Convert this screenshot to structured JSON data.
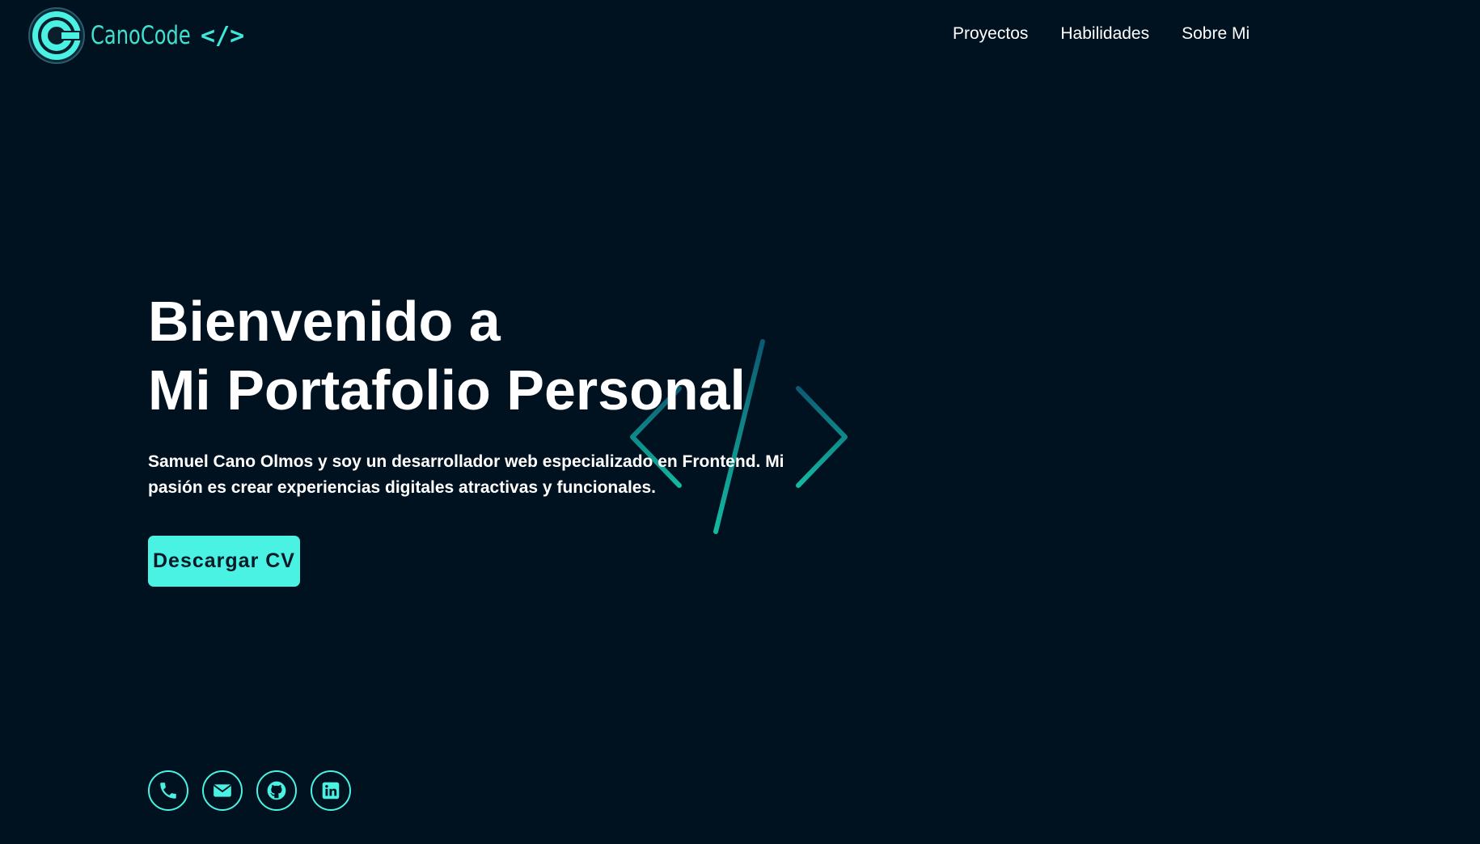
{
  "brand": {
    "name": "CanoCode",
    "tag": "</>",
    "logo_icon": "c-circle-logo-icon",
    "accent_color": "#49f2e3"
  },
  "nav": {
    "items": [
      {
        "label": "Proyectos"
      },
      {
        "label": "Habilidades"
      },
      {
        "label": "Sobre Mi"
      }
    ]
  },
  "hero": {
    "title_line1": "Bienvenido a",
    "title_line2": "Mi Portafolio Personal",
    "description": "Samuel Cano Olmos y soy un desarrollador web especializado en Frontend. Mi pasión es crear experiencias digitales atractivas y funcionales.",
    "cv_button_label": "Descargar CV",
    "decoration_icon": "code-brackets-icon"
  },
  "social": {
    "items": [
      {
        "icon": "phone-icon"
      },
      {
        "icon": "email-icon"
      },
      {
        "icon": "github-icon"
      },
      {
        "icon": "linkedin-icon"
      }
    ]
  },
  "colors": {
    "background": "#001220",
    "accent": "#49f2e3",
    "text": "#ffffff"
  }
}
